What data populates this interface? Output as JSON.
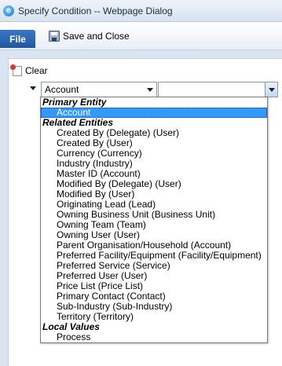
{
  "window": {
    "title": "Specify Condition -- Webpage Dialog"
  },
  "toolbar": {
    "file_label": "File",
    "save_close_label": "Save and Close"
  },
  "actions": {
    "clear_label": "Clear"
  },
  "condition": {
    "field_value": "Account",
    "operator_value": "",
    "partial_link": "Su"
  },
  "dropdown": {
    "groups": [
      {
        "label": "Primary Entity",
        "options": [
          "Account"
        ]
      },
      {
        "label": "Related Entities",
        "options": [
          "Created By (Delegate) (User)",
          "Created By (User)",
          "Currency (Currency)",
          "Industry (Industry)",
          "Master ID (Account)",
          "Modified By (Delegate) (User)",
          "Modified By (User)",
          "Originating Lead (Lead)",
          "Owning Business Unit (Business Unit)",
          "Owning Team (Team)",
          "Owning User (User)",
          "Parent Organisation/Household (Account)",
          "Preferred Facility/Equipment (Facility/Equipment)",
          "Preferred Service (Service)",
          "Preferred User (User)",
          "Price List (Price List)",
          "Primary Contact (Contact)",
          "Sub-Industry (Sub-Industry)",
          "Territory (Territory)"
        ]
      },
      {
        "label": "Local Values",
        "options": [
          "Process"
        ]
      }
    ],
    "selected": "Account"
  },
  "colors": {
    "selection": "#3399ff",
    "file_button": "#2a62b0",
    "chrome_background": "#dbe5f1"
  },
  "icons": {
    "title": "ie-icon",
    "save": "save-icon",
    "clear": "clear-icon"
  }
}
